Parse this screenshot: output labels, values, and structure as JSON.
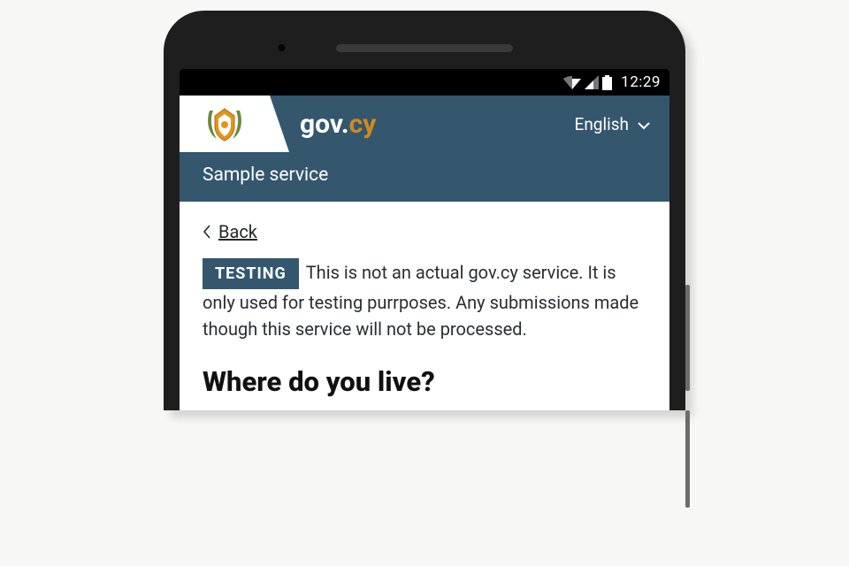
{
  "statusbar": {
    "clock": "12:29"
  },
  "brand": {
    "gov": "gov.",
    "cy": "cy"
  },
  "language": {
    "selected": "English"
  },
  "service": {
    "name": "Sample service"
  },
  "back": {
    "label": "Back"
  },
  "notice": {
    "tag": "TESTING",
    "text": "This is not an actual gov.cy service. It is only used for testing purrposes. Any submissions made though this service will not be processed."
  },
  "page": {
    "heading": "Where do you live?"
  }
}
